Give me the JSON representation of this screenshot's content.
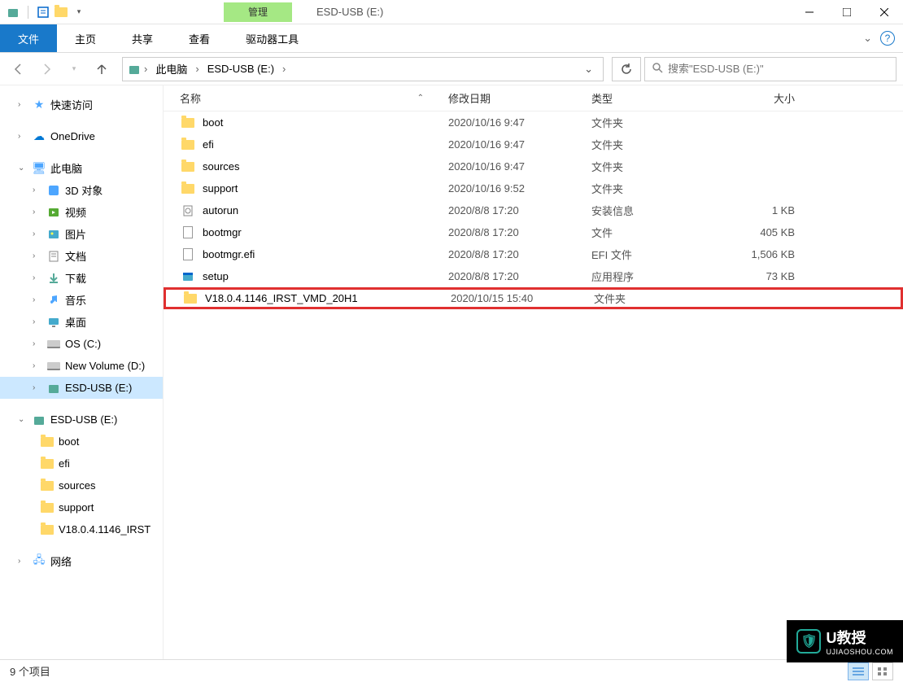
{
  "titlebar": {
    "context_tab": "管理",
    "title": "ESD-USB (E:)"
  },
  "ribbon": {
    "file": "文件",
    "home": "主页",
    "share": "共享",
    "view": "查看",
    "drive_tools": "驱动器工具"
  },
  "breadcrumb": {
    "items": [
      "此电脑",
      "ESD-USB (E:)"
    ]
  },
  "search": {
    "placeholder": "搜索\"ESD-USB (E:)\""
  },
  "sidebar": {
    "quick_access": "快速访问",
    "onedrive": "OneDrive",
    "this_pc": "此电脑",
    "this_pc_children": [
      {
        "label": "3D 对象",
        "icon": "3d"
      },
      {
        "label": "视频",
        "icon": "video"
      },
      {
        "label": "图片",
        "icon": "pictures"
      },
      {
        "label": "文档",
        "icon": "documents"
      },
      {
        "label": "下载",
        "icon": "downloads"
      },
      {
        "label": "音乐",
        "icon": "music"
      },
      {
        "label": "桌面",
        "icon": "desktop"
      },
      {
        "label": "OS (C:)",
        "icon": "disk"
      },
      {
        "label": "New Volume (D:)",
        "icon": "disk"
      },
      {
        "label": "ESD-USB (E:)",
        "icon": "usb",
        "selected": true
      }
    ],
    "esd_usb": "ESD-USB (E:)",
    "esd_children": [
      "boot",
      "efi",
      "sources",
      "support",
      "V18.0.4.1146_IRST"
    ],
    "network": "网络"
  },
  "columns": {
    "name": "名称",
    "date": "修改日期",
    "type": "类型",
    "size": "大小"
  },
  "files": [
    {
      "name": "boot",
      "date": "2020/10/16 9:47",
      "type": "文件夹",
      "size": "",
      "icon": "folder"
    },
    {
      "name": "efi",
      "date": "2020/10/16 9:47",
      "type": "文件夹",
      "size": "",
      "icon": "folder"
    },
    {
      "name": "sources",
      "date": "2020/10/16 9:47",
      "type": "文件夹",
      "size": "",
      "icon": "folder"
    },
    {
      "name": "support",
      "date": "2020/10/16 9:52",
      "type": "文件夹",
      "size": "",
      "icon": "folder"
    },
    {
      "name": "autorun",
      "date": "2020/8/8 17:20",
      "type": "安装信息",
      "size": "1 KB",
      "icon": "inf"
    },
    {
      "name": "bootmgr",
      "date": "2020/8/8 17:20",
      "type": "文件",
      "size": "405 KB",
      "icon": "file"
    },
    {
      "name": "bootmgr.efi",
      "date": "2020/8/8 17:20",
      "type": "EFI 文件",
      "size": "1,506 KB",
      "icon": "file"
    },
    {
      "name": "setup",
      "date": "2020/8/8 17:20",
      "type": "应用程序",
      "size": "73 KB",
      "icon": "exe"
    },
    {
      "name": "V18.0.4.1146_IRST_VMD_20H1",
      "date": "2020/10/15 15:40",
      "type": "文件夹",
      "size": "",
      "icon": "folder",
      "highlighted": true
    }
  ],
  "statusbar": {
    "count": "9 个项目"
  },
  "watermark": {
    "main": "U教授",
    "sub": "UJIAOSHOU.COM"
  }
}
